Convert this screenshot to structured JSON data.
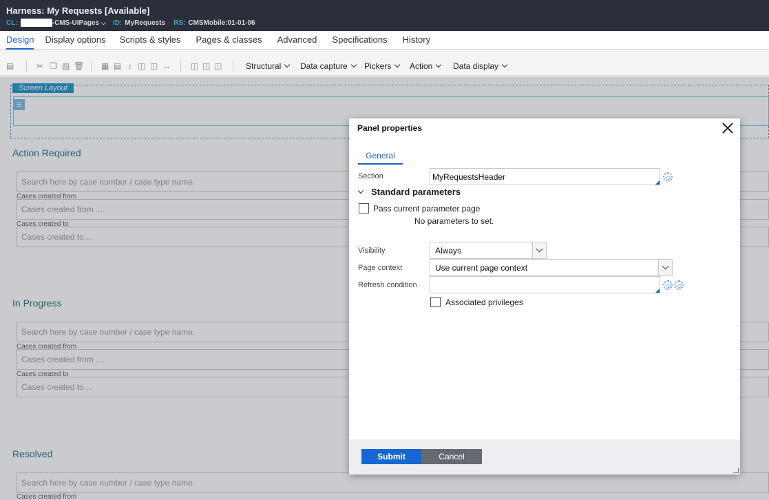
{
  "header": {
    "title": "Harness: My Requests [Available]",
    "cl_key": "CL:",
    "cl_value": "-CMS-UIPages",
    "id_key": "ID:",
    "id_value": "MyRequests",
    "rs_key": "RS:",
    "rs_value": "CMSMobile:01-01-06"
  },
  "tabs": [
    {
      "label": "Design"
    },
    {
      "label": "Display options"
    },
    {
      "label": "Scripts & styles"
    },
    {
      "label": "Pages & classes"
    },
    {
      "label": "Advanced"
    },
    {
      "label": "Specifications"
    },
    {
      "label": "History"
    }
  ],
  "toolbar": {
    "menus": [
      {
        "label": "Structural"
      },
      {
        "label": "Data capture"
      },
      {
        "label": "Pickers"
      },
      {
        "label": "Action"
      },
      {
        "label": "Data display"
      }
    ]
  },
  "canvas": {
    "screen_layout_label": "Screen Layout",
    "sections": [
      {
        "heading": "Action Required",
        "search_placeholder": "Search here by case number / case type name.",
        "from_label": "Cases created from",
        "from_placeholder": "Cases created from ....",
        "to_label": "Cases created to",
        "to_placeholder": "Cases created to...."
      },
      {
        "heading": "In Progress",
        "search_placeholder": "Search here by case number / case type name.",
        "from_label": "Cases created from",
        "from_placeholder": "Cases created from ....",
        "to_label": "Cases created to",
        "to_placeholder": "Cases created to...."
      },
      {
        "heading": "Resolved",
        "search_placeholder": "Search here by case number / case type name.",
        "from_label": "Cases created from"
      }
    ]
  },
  "modal": {
    "title": "Panel properties",
    "tab_general": "General",
    "section_label": "Section",
    "section_value": "MyRequestsHeader",
    "standard_parameters": "Standard parameters",
    "pass_param_label": "Pass current parameter page",
    "no_params": "No parameters to set.",
    "visibility_label": "Visibility",
    "visibility_value": "Always",
    "page_context_label": "Page context",
    "page_context_value": "Use current page context",
    "refresh_label": "Refresh condition",
    "refresh_value": "",
    "assoc_priv_label": "Associated privileges",
    "submit_label": "Submit",
    "cancel_label": "Cancel"
  }
}
